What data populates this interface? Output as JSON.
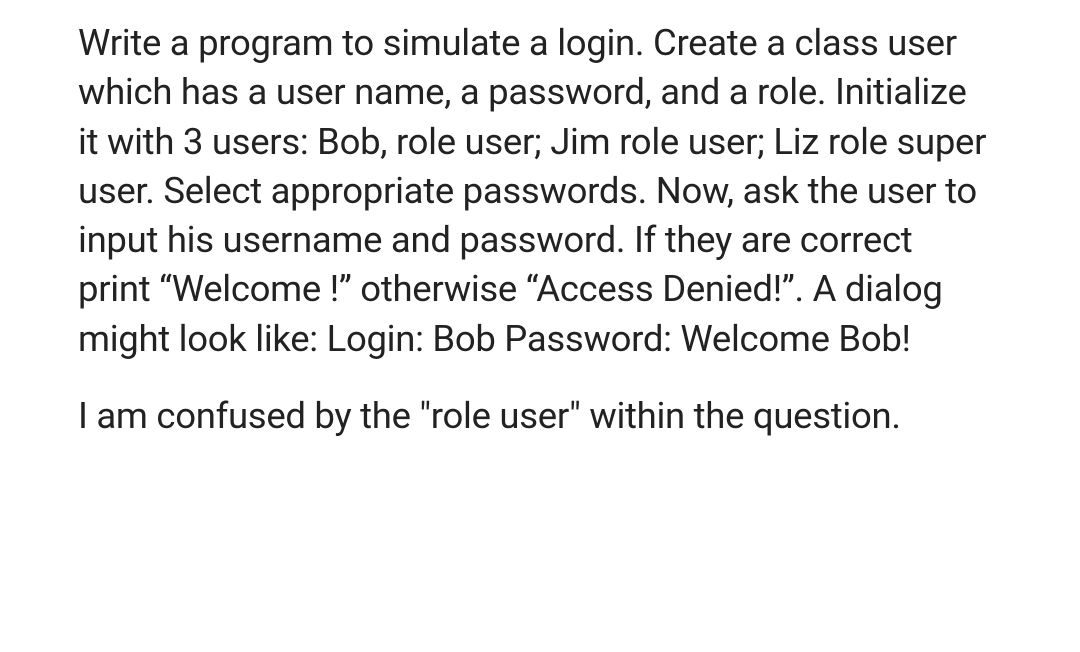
{
  "paragraphs": {
    "p1": "Write a program to simulate a login. Create a class user which has a user name, a password, and a role. Initialize it with 3 users: Bob, role user; Jim role user; Liz role super user. Select appropriate passwords. Now, ask the user to input his username and password. If they are correct print “Welcome !” otherwise “Access Denied!”. A dialog might look like: Login: Bob Password: Welcome Bob!",
    "p2": "I am confused by the \"role user\" within the question."
  }
}
